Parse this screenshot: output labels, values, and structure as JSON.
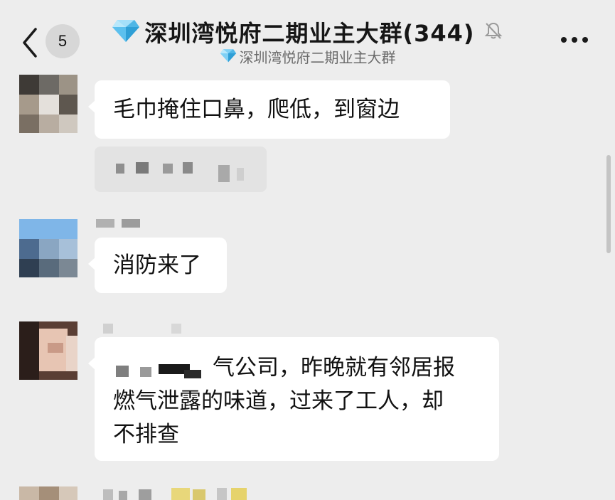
{
  "header": {
    "unread_count": "5",
    "title": "深圳湾悦府二期业主大群(344)",
    "subtitle": "深圳湾悦府二期业主大群",
    "icons": {
      "back": "back-chevron-icon",
      "title_emoji": "diamond-icon",
      "mute": "muted-bell-icon",
      "more": "more-dots-icon"
    }
  },
  "messages": [
    {
      "text": "毛巾掩住口鼻，爬低，到窗边"
    },
    {
      "text": "消防来了"
    },
    {
      "lines": [
        "气公司，昨晚就有邻居报",
        "燃气泄露的味道，过来了工人，却",
        "不排查"
      ]
    }
  ],
  "colors": {
    "background": "#ededed",
    "bubble": "#ffffff",
    "title": "#161616",
    "subtitle": "#6b6b6b"
  }
}
